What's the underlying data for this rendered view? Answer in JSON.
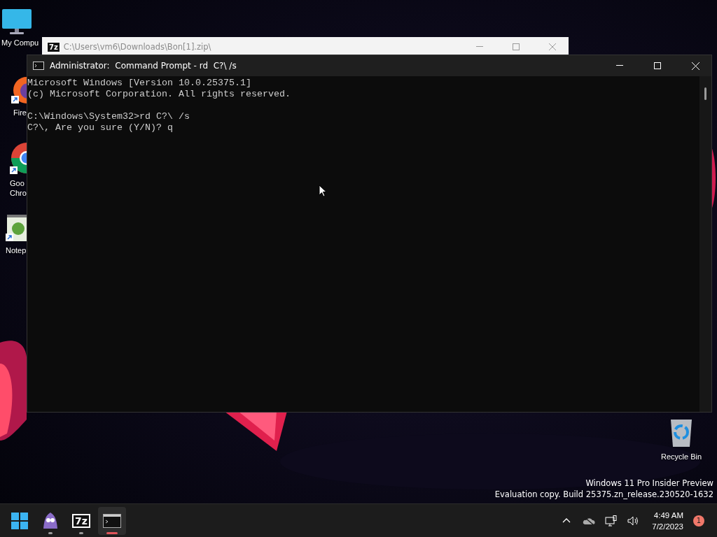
{
  "desktop_icons": [
    {
      "kind": "computer",
      "shortcut": false,
      "label_lines": [
        "My Compu"
      ]
    },
    {
      "kind": "firefox",
      "shortcut": true,
      "label_lines": [
        "Fire"
      ]
    },
    {
      "kind": "chrome",
      "shortcut": true,
      "label_lines": [
        "Goo",
        "Chro"
      ]
    },
    {
      "kind": "notepad",
      "shortcut": true,
      "label_lines": [
        "Notep"
      ]
    },
    {
      "kind": "recycle",
      "shortcut": false,
      "label_lines": [
        "Recycle Bin"
      ]
    }
  ],
  "back_window": {
    "app_badge": "7z",
    "title": "C:\\Users\\vm6\\Downloads\\Bon[1].zip\\"
  },
  "console": {
    "title": "Administrator:  Command Prompt - rd  C?\\ /s",
    "blocks": [
      [
        "Microsoft Windows [Version 10.0.25375.1]",
        "(c) Microsoft Corporation. All rights reserved."
      ],
      [
        "C:\\Windows\\System32>rd C?\\ /s",
        "C?\\, Are you sure (Y/N)? q"
      ]
    ]
  },
  "build_info": [
    "Windows 11 Pro Insider Preview",
    "Evaluation copy. Build 25375.zn_release.230520-1632"
  ],
  "taskbar": {
    "apps": [
      {
        "kind": "start",
        "running": false,
        "active": false
      },
      {
        "kind": "bubble",
        "running": true,
        "active": false
      },
      {
        "kind": "sevenzip",
        "label": "7z",
        "running": true,
        "active": false
      },
      {
        "kind": "terminal",
        "running": true,
        "active": true
      }
    ],
    "time": "4:49 AM",
    "date": "7/2/2023",
    "notification_count": "1"
  }
}
